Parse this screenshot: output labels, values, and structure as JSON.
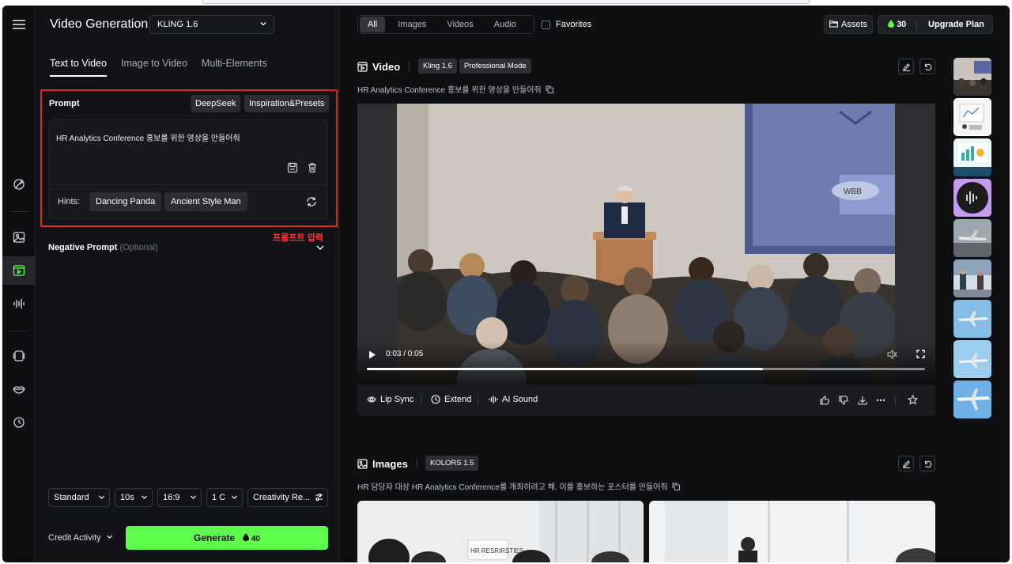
{
  "panel": {
    "title": "Video Generation",
    "model": "KLING 1.6",
    "tabs": [
      {
        "label": "Text to Video",
        "active": true
      },
      {
        "label": "Image to Video",
        "active": false
      },
      {
        "label": "Multi-Elements",
        "active": false
      }
    ],
    "prompt": {
      "label": "Prompt",
      "deepseek_label": "DeepSeek",
      "presets_label": "Inspiration&Presets",
      "text": "HR Analytics Conference 홍보를 위한 영상을 만들어줘",
      "hints_label": "Hints:",
      "hints": [
        "Dancing Panda",
        "Ancient Style Man"
      ]
    },
    "annotation": "프롬프트 입력",
    "negative_prompt": {
      "label": "Negative Prompt",
      "optional": "(Optional)"
    },
    "settings": {
      "mode": "Standard",
      "duration": "10s",
      "ratio": "16:9",
      "count": "1 C",
      "creativity": "Creativity Re..."
    },
    "credit_activity": "Credit Activity",
    "generate_label": "Generate",
    "generate_cost": "40"
  },
  "filters": {
    "items": [
      {
        "label": "All",
        "active": true
      },
      {
        "label": "Images",
        "active": false
      },
      {
        "label": "Videos",
        "active": false
      },
      {
        "label": "Audio",
        "active": false
      }
    ],
    "favorites": "Favorites"
  },
  "topbar": {
    "assets_label": "Assets",
    "credits": "30",
    "upgrade_label": "Upgrade Plan"
  },
  "video_section": {
    "title": "Video",
    "model_badge": "Kling 1.6",
    "mode_badge": "Professional Mode",
    "prompt": "HR Analytics Conference 홍보를 위한 영상을 만들어줘",
    "time": "0:03 / 0:05",
    "progress": 0.71,
    "actions": [
      "Lip Sync",
      "Extend",
      "AI Sound"
    ]
  },
  "images_section": {
    "title": "Images",
    "model_badge": "KOLORS 1.5",
    "prompt": "HR 담당자 대상 HR Analytics Conference를 개최하려고 해. 이를 홍보하는 포스터를 만들어줘",
    "sign_text": "HR RESRIRSTIES"
  },
  "video_scene": {
    "screen_text": "WBB"
  },
  "icons": {
    "rail": [
      "menu-icon",
      "sparkle-icon",
      "image-icon",
      "video-icon",
      "audio-wave-icon",
      "layers-icon",
      "lips-icon",
      "history-icon"
    ]
  }
}
